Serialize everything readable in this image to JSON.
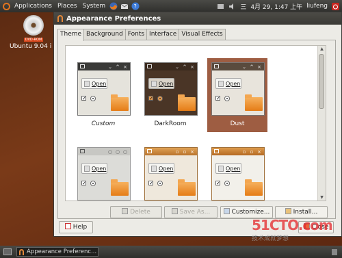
{
  "top_panel": {
    "menus": [
      "Applications",
      "Places",
      "System"
    ],
    "clock": "4月 29, 1:47 上午",
    "user": "liufeng",
    "input_method": "三"
  },
  "desktop_icon": {
    "label": "Ubuntu 9.04 i",
    "disc_label": "DVD-ROM"
  },
  "window": {
    "title": "Appearance Preferences",
    "tabs": [
      "Theme",
      "Background",
      "Fonts",
      "Interface",
      "Visual Effects"
    ],
    "active_tab": "Theme",
    "themes": [
      {
        "name": "Custom",
        "selected": false
      },
      {
        "name": "DarkRoom",
        "selected": false
      },
      {
        "name": "Dust",
        "selected": true
      },
      {
        "name": "",
        "selected": false
      },
      {
        "name": "",
        "selected": false
      },
      {
        "name": "",
        "selected": false
      }
    ],
    "preview_button_label": "Open",
    "buttons": {
      "delete": "Delete",
      "save_as": "Save As...",
      "customize": "Customize...",
      "install": "Install...",
      "help": "Help",
      "close": "Close"
    }
  },
  "taskbar": {
    "window_button": "Appearance Preferenc..."
  },
  "watermark": {
    "text": "51CTO.com",
    "subtext": "技术成就梦想"
  },
  "colors": {
    "selection": "#9e5d42",
    "desktop": "#6b3215",
    "accent_orange": "#e57c16"
  }
}
